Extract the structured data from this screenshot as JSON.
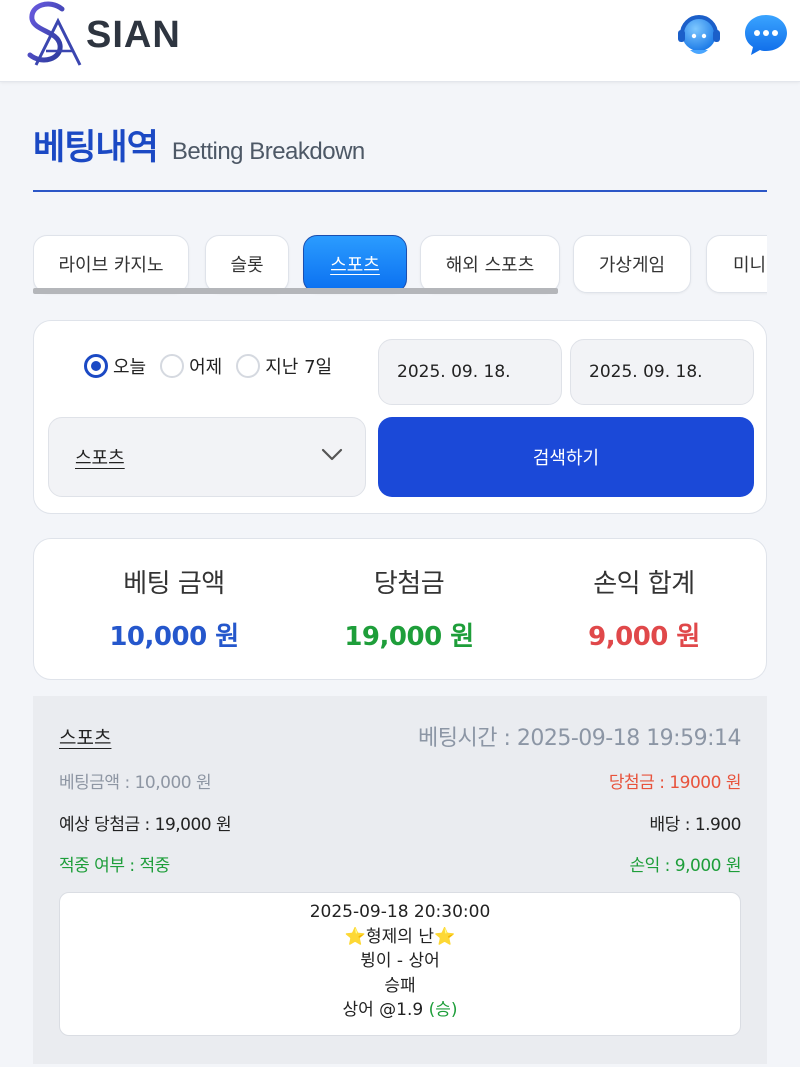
{
  "header": {
    "logo_text": "SIAN",
    "icons": [
      "support-agent-icon",
      "chat-bubble-icon"
    ]
  },
  "page": {
    "title_ko": "베팅내역",
    "title_en": "Betting Breakdown"
  },
  "tabs": [
    {
      "label": "라이브 카지노",
      "active": false
    },
    {
      "label": "슬롯",
      "active": false
    },
    {
      "label": "스포츠",
      "active": true
    },
    {
      "label": "해외 스포츠",
      "active": false
    },
    {
      "label": "가상게임",
      "active": false
    },
    {
      "label": "미니게임",
      "active": false
    }
  ],
  "filter": {
    "radios": [
      {
        "label": "오늘",
        "checked": true
      },
      {
        "label": "어제",
        "checked": false
      },
      {
        "label": "지난 7일",
        "checked": false
      }
    ],
    "date_from": "2025. 09. 18.",
    "date_to": "2025. 09. 18.",
    "category_select": "스포츠",
    "search_label": "검색하기"
  },
  "summary": {
    "bet_label": "베팅 금액",
    "bet_value": "10,000 원",
    "win_label": "당첨금",
    "win_value": "19,000 원",
    "profit_label": "손익 합계",
    "profit_value": "9,000 원"
  },
  "record": {
    "category": "스포츠",
    "bet_time": "베팅시간 : 2025-09-18 19:59:14",
    "bet_amount": "베팅금액 : 10,000 원",
    "win_amount": "당첨금 : 19000 원",
    "expected_win": "예상 당첨금 : 19,000 원",
    "odds": "배당 : 1.900",
    "hit_status": "적중 여부 : 적중",
    "profit": "손익 : 9,000 원",
    "detail": {
      "match_time": "2025-09-18 20:30:00",
      "league": "⭐형제의 난⭐",
      "teams": "뷩이 - 상어",
      "market": "승패",
      "pick": "상어 @1.9",
      "result": "(승)"
    }
  },
  "colors": {
    "accent": "#1b49c4",
    "button": "#1b49d8",
    "bet_blue": "#2557cc",
    "win_green": "#1e9e3a",
    "loss_red": "#e0484a",
    "win_amount_red": "#e8533c"
  }
}
